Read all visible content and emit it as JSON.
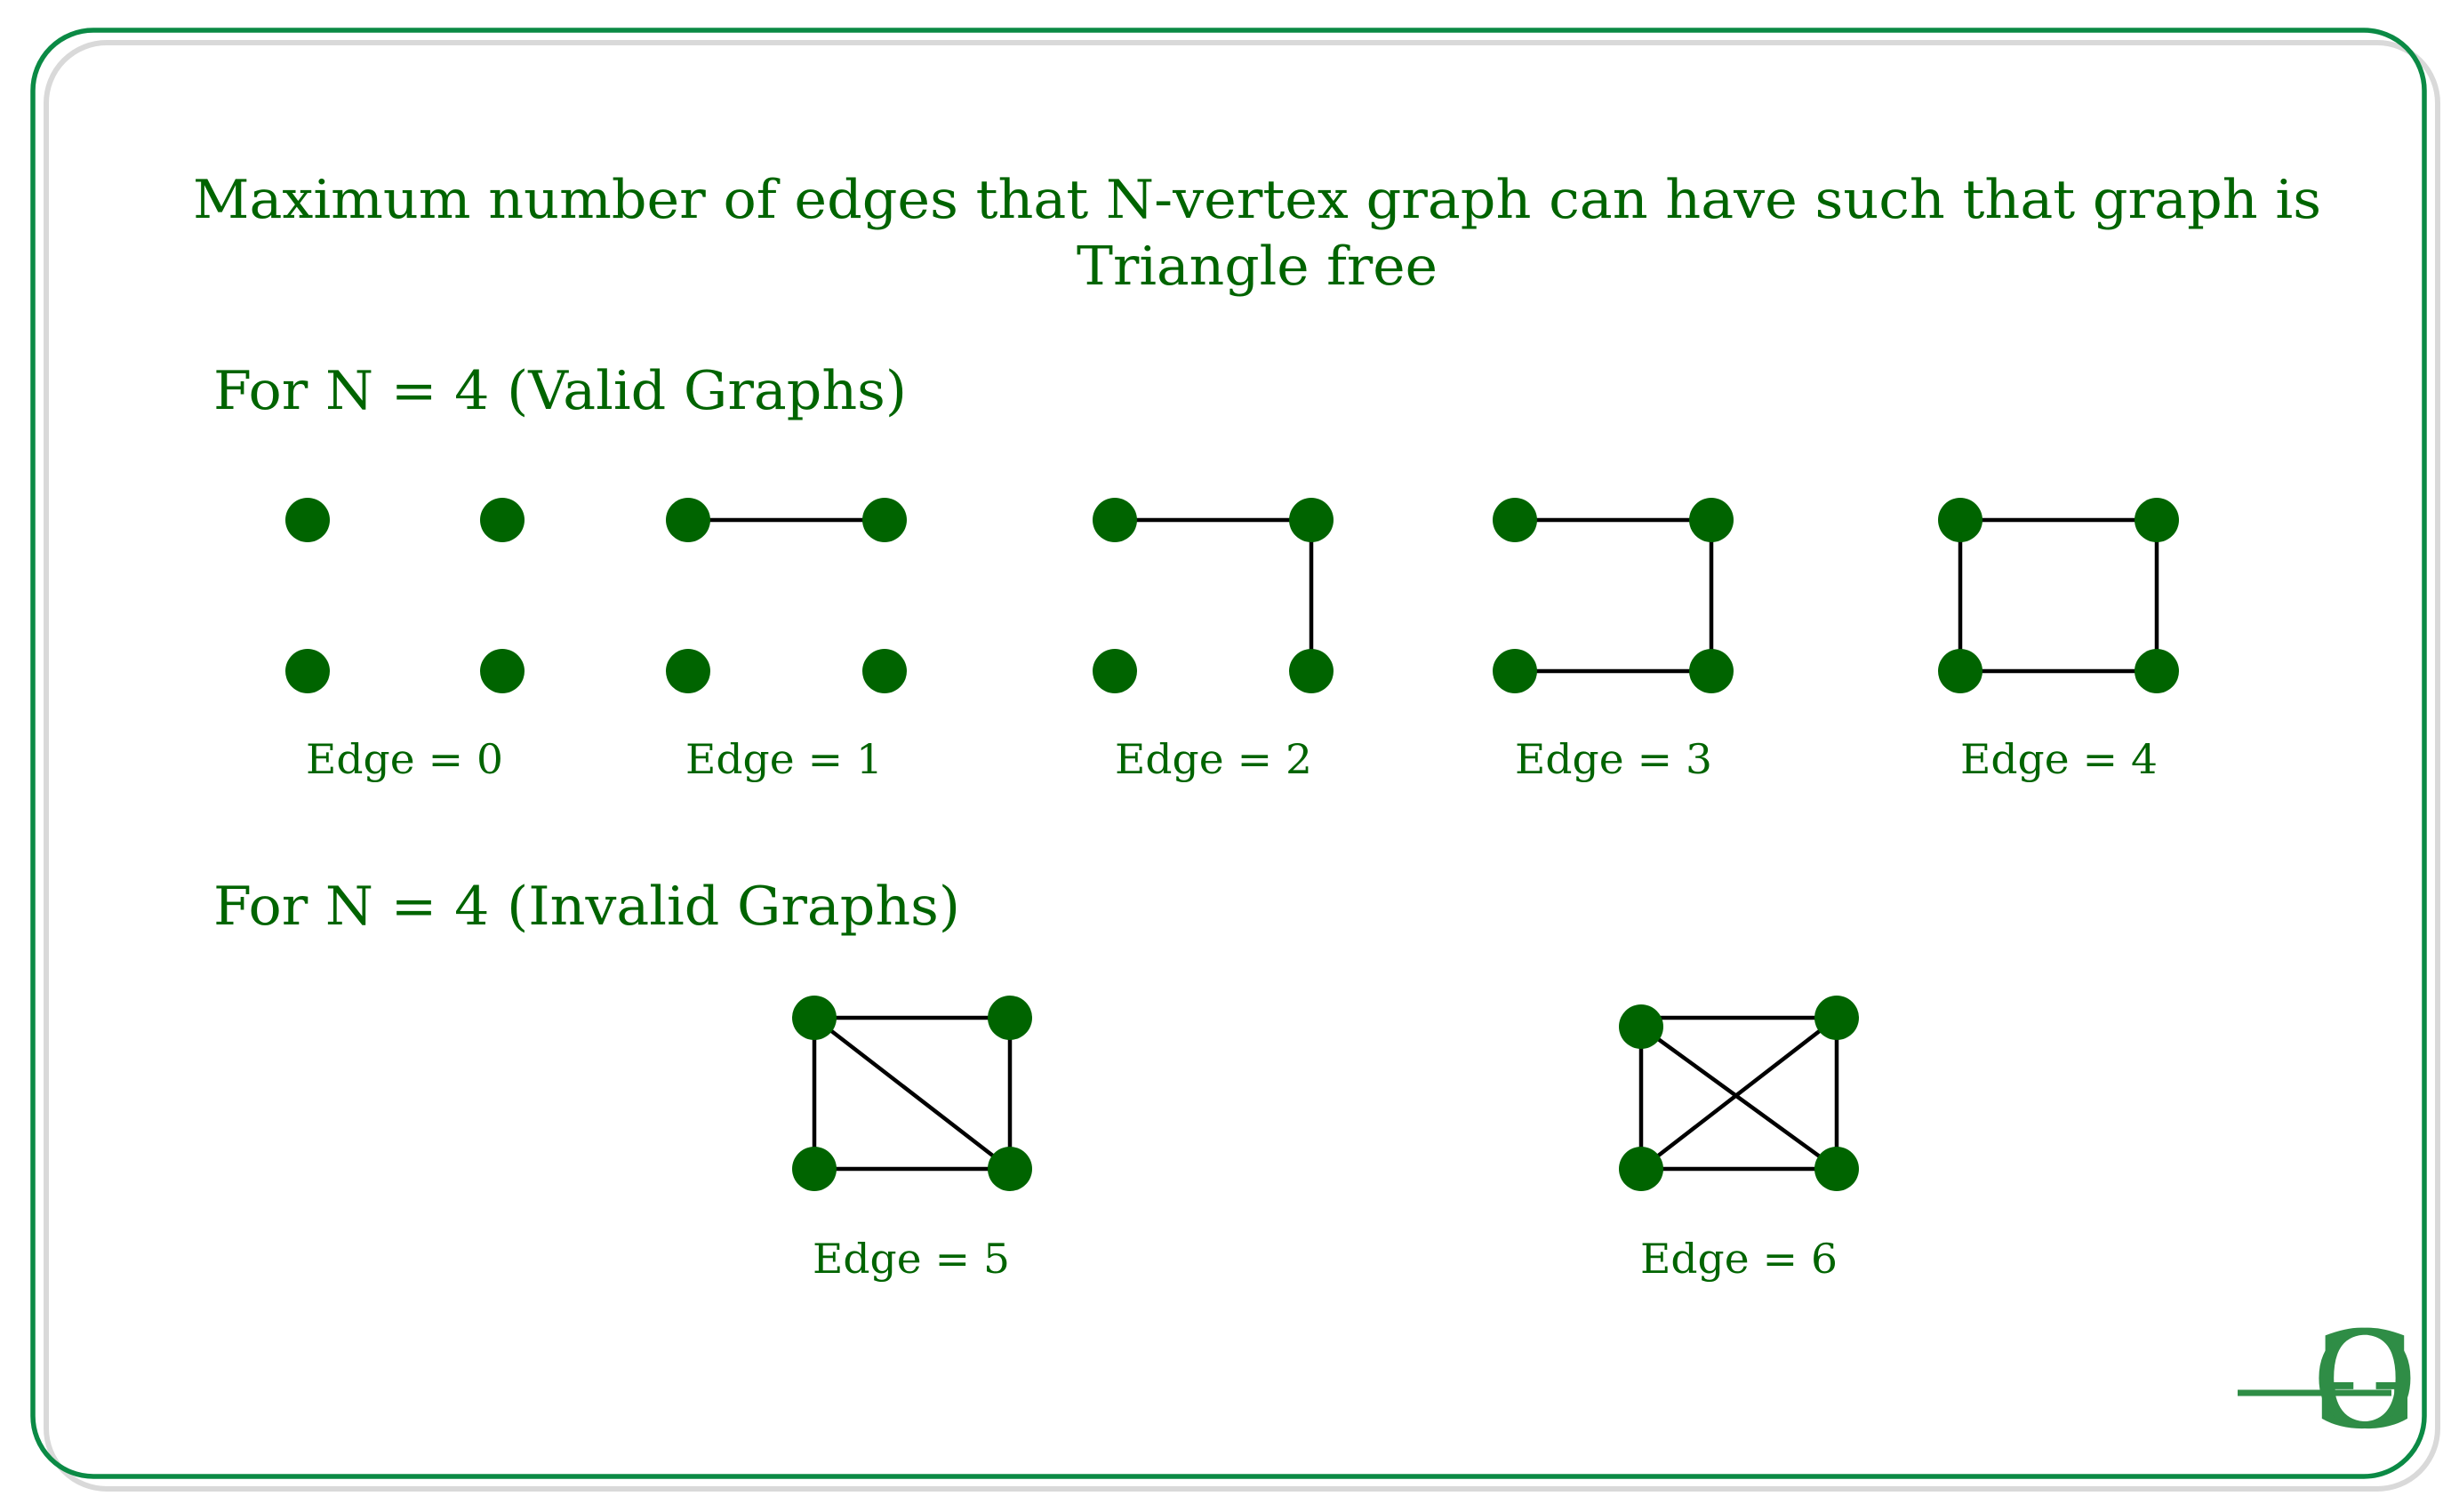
{
  "title": {
    "line1": "Maximum number of edges that N-vertex graph can have such that graph is",
    "line2": "Triangle free"
  },
  "sections": [
    {
      "heading": "For N = 4 (Valid Graphs)",
      "graphs": [
        {
          "label": "Edge = 0",
          "edges": []
        },
        {
          "label": "Edge = 1",
          "edges": [
            [
              "tl",
              "tr"
            ]
          ]
        },
        {
          "label": "Edge = 2",
          "edges": [
            [
              "tl",
              "tr"
            ],
            [
              "tr",
              "br"
            ]
          ]
        },
        {
          "label": "Edge = 3",
          "edges": [
            [
              "tl",
              "tr"
            ],
            [
              "tr",
              "br"
            ],
            [
              "bl",
              "br"
            ]
          ]
        },
        {
          "label": "Edge = 4",
          "edges": [
            [
              "tl",
              "tr"
            ],
            [
              "tr",
              "br"
            ],
            [
              "bl",
              "br"
            ],
            [
              "tl",
              "bl"
            ]
          ]
        }
      ]
    },
    {
      "heading": "For N = 4 (Invalid Graphs)",
      "graphs": [
        {
          "label": "Edge = 5",
          "edges": [
            [
              "tl",
              "tr"
            ],
            [
              "tr",
              "br"
            ],
            [
              "bl",
              "br"
            ],
            [
              "tl",
              "bl"
            ],
            [
              "tl",
              "br"
            ]
          ]
        },
        {
          "label": "Edge = 6",
          "edges": [
            [
              "tl",
              "tr"
            ],
            [
              "tr",
              "br"
            ],
            [
              "bl",
              "br"
            ],
            [
              "tl",
              "bl"
            ],
            [
              "tl",
              "br"
            ],
            [
              "tr",
              "bl"
            ]
          ]
        }
      ]
    }
  ],
  "vertices_per_graph": 4,
  "logo": {
    "text": "GG",
    "icon": "geeksforgeeks-logo"
  },
  "colors": {
    "text": "#006400",
    "node": "#006400",
    "edge": "#000000",
    "frame": "#0b8a45",
    "frame_shadow": "#d9d9d9",
    "logo": "#2f8d46"
  }
}
